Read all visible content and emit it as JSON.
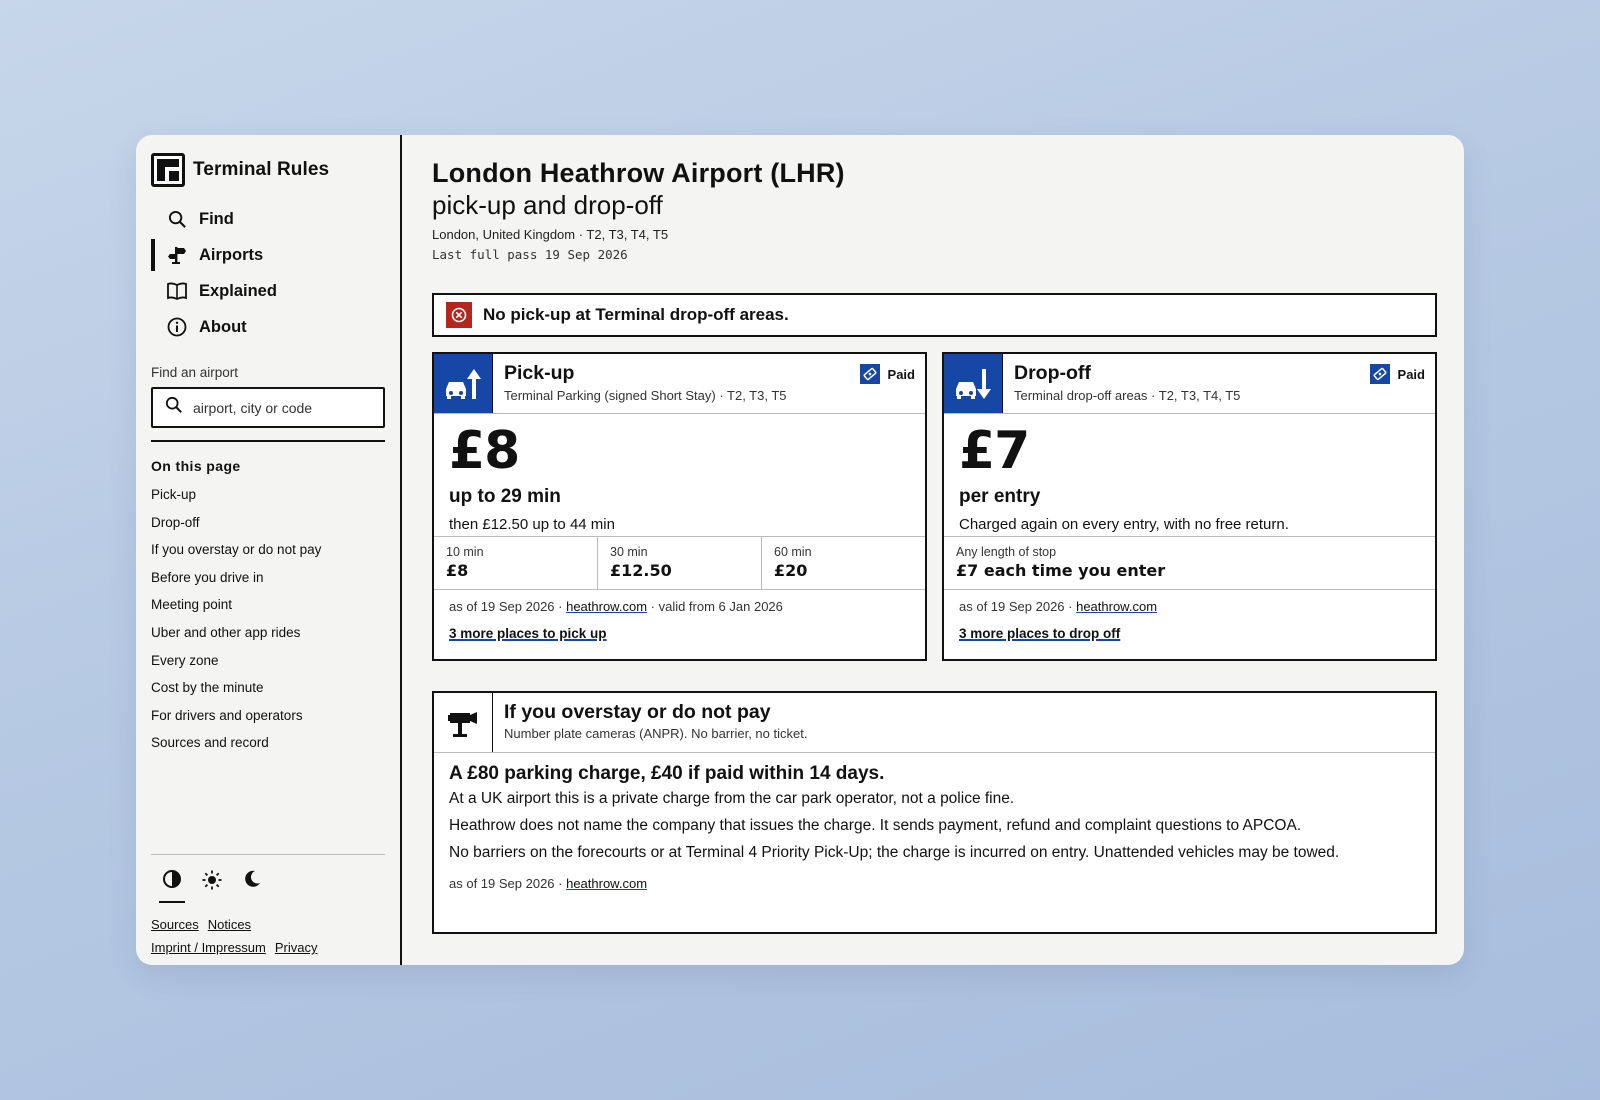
{
  "brand": {
    "name": "Terminal Rules"
  },
  "nav": [
    {
      "label": "Find",
      "icon": "search-icon"
    },
    {
      "label": "Airports",
      "icon": "signpost-icon",
      "active": true
    },
    {
      "label": "Explained",
      "icon": "book-icon"
    },
    {
      "label": "About",
      "icon": "info-icon"
    }
  ],
  "search": {
    "label": "Find an airport",
    "placeholder": "airport, city or code"
  },
  "toc": {
    "title": "On this page",
    "items": [
      "Pick-up",
      "Drop-off",
      "If you overstay or do not pay",
      "Before you drive in",
      "Meeting point",
      "Uber and other app rides",
      "Every zone",
      "Cost by the minute",
      "For drivers and operators",
      "Sources and record"
    ]
  },
  "theme": {
    "options": [
      "contrast-icon",
      "sun-icon",
      "moon-icon"
    ],
    "selected": 0
  },
  "footer_links": [
    "Sources",
    "Notices",
    "Imprint / Impressum",
    "Privacy"
  ],
  "page": {
    "title": "London Heathrow Airport (LHR)",
    "subtitle": "pick-up and drop-off",
    "location": "London, United Kingdom · T2, T3, T4, T5",
    "last_pass": "Last full pass 19 Sep 2026"
  },
  "alert": {
    "text": "No pick-up at Terminal drop-off areas.",
    "color": "#b3261e"
  },
  "pickup": {
    "title": "Pick-up",
    "subtitle": "Terminal Parking (signed Short Stay) · T2, T3, T5",
    "badge": "Paid",
    "price": "£8",
    "price_main": "up to 29 min",
    "price_then": "then £12.50 up to 44 min",
    "tiers": [
      {
        "label": "10 min",
        "value": "£8"
      },
      {
        "label": "30 min",
        "value": "£12.50"
      },
      {
        "label": "60 min",
        "value": "£20"
      }
    ],
    "asof_prefix": "as of 19 Sep 2026 · ",
    "source": "heathrow.com",
    "asof_suffix": " · valid from 6 Jan 2026",
    "more": "3 more places to pick up"
  },
  "dropoff": {
    "title": "Drop-off",
    "subtitle": "Terminal drop-off areas · T2, T3, T4, T5",
    "badge": "Paid",
    "price": "£7",
    "price_main": "per entry",
    "price_then": "Charged again on every entry, with no free return.",
    "tier": {
      "label": "Any length of stop",
      "value": "£7 each time you enter"
    },
    "asof_prefix": "as of 19 Sep 2026 · ",
    "source": "heathrow.com",
    "more": "3 more places to drop off"
  },
  "overstay": {
    "title": "If you overstay or do not pay",
    "subtitle": "Number plate cameras (ANPR). No barrier, no ticket.",
    "lead": "A £80 parking charge, £40 if paid within 14 days.",
    "p1": "At a UK airport this is a private charge from the car park operator, not a police fine.",
    "p2": "Heathrow does not name the company that issues the charge. It sends payment, refund and complaint questions to APCOA.",
    "p3": "No barriers on the forecourts or at Terminal 4 Priority Pick-Up; the charge is incurred on entry. Unattended vehicles may be towed.",
    "asof_prefix": "as of 19 Sep 2026 · ",
    "source": "heathrow.com"
  },
  "colors": {
    "accent": "#1747a6",
    "alert": "#b3261e",
    "panel": "#f4f4f2"
  }
}
